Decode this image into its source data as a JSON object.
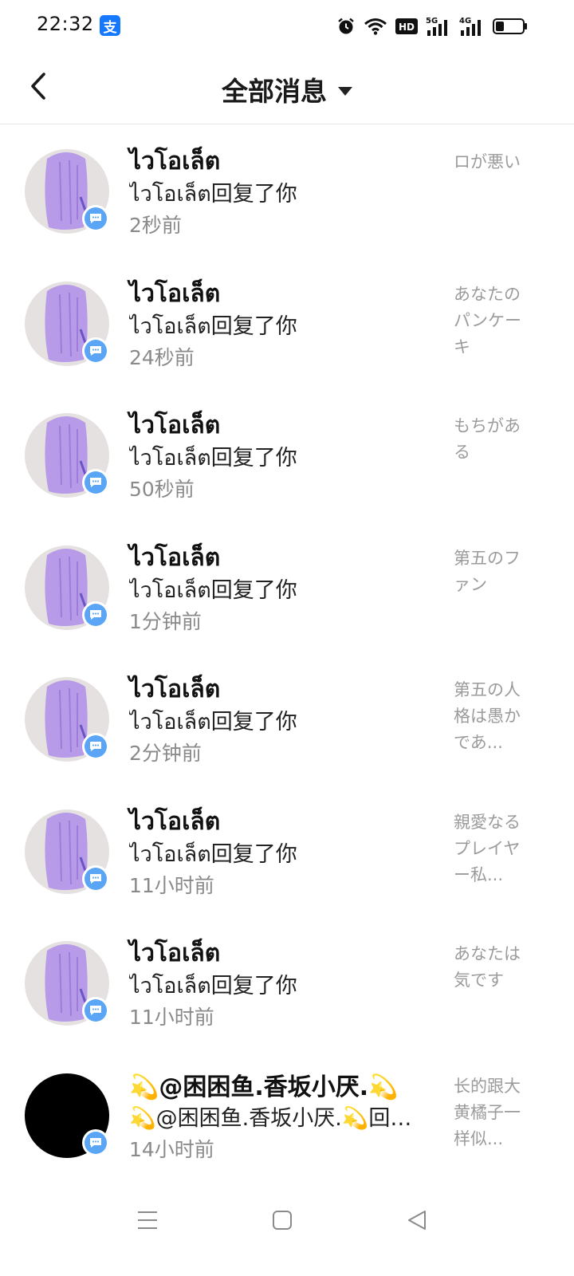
{
  "status_bar": {
    "time": "22:32",
    "app_badge": "支",
    "icons": [
      "alarm-icon",
      "wifi-icon",
      "hd-icon",
      "signal-5g-icon",
      "signal-4g-icon",
      "battery-icon"
    ],
    "hd_label": "HD",
    "net1": "5G",
    "net2": "4G"
  },
  "header": {
    "title": "全部消息",
    "back_icon": "chevron-left-icon",
    "dropdown_icon": "caret-down-icon"
  },
  "messages": [
    {
      "name": "ไวโอเล็ต",
      "desc": "ไวโอเล็ต回复了你",
      "time": "2秒前",
      "preview": "ロが悪い"
    },
    {
      "name": "ไวโอเล็ต",
      "desc": "ไวโอเล็ต回复了你",
      "time": "24秒前",
      "preview": "あなたのパンケーキ"
    },
    {
      "name": "ไวโอเล็ต",
      "desc": "ไวโอเล็ต回复了你",
      "time": "50秒前",
      "preview": "もちがある"
    },
    {
      "name": "ไวโอเล็ต",
      "desc": "ไวโอเล็ต回复了你",
      "time": "1分钟前",
      "preview": "第五のファン"
    },
    {
      "name": "ไวโอเล็ต",
      "desc": "ไวโอเล็ต回复了你",
      "time": "2分钟前",
      "preview": "第五の人格は愚かであ..."
    },
    {
      "name": "ไวโอเล็ต",
      "desc": "ไวโอเล็ต回复了你",
      "time": "11小时前",
      "preview": "親愛なるプレイヤー私..."
    },
    {
      "name": "ไวโอเล็ต",
      "desc": "ไวโอเล็ต回复了你",
      "time": "11小时前",
      "preview": "あなたは気です"
    },
    {
      "name": "💫@困困鱼.香坂小厌.💫",
      "desc": "💫@困困鱼.香坂小厌.💫回复...",
      "time": "14小时前",
      "preview": "长的跟大黄橘子一样似..."
    }
  ],
  "nav_bar": {
    "icons": [
      "menu-icon",
      "home-square-icon",
      "back-triangle-icon"
    ]
  },
  "colors": {
    "accent_blue": "#5aa5f5",
    "badge_blue": "#1677ff",
    "avatar_hair": "#b79ae8",
    "avatar_bg": "#e6e1e1"
  }
}
